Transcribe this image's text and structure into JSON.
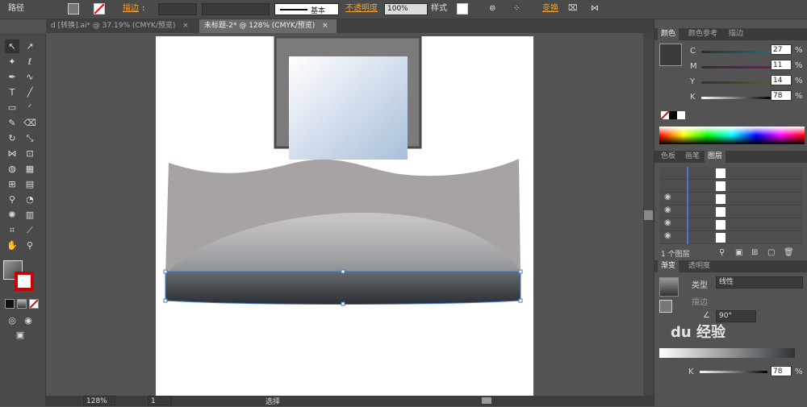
{
  "control_bar": {
    "path_label": "路径",
    "stroke_label": "描边",
    "stroke_style_label": "基本",
    "opacity_label": "不透明度",
    "opacity_value": "100%",
    "style_label": "样式",
    "transform_label": "变换"
  },
  "document_tabs": [
    {
      "label": "d [转换].ai* @ 37.19% (CMYK/预览)",
      "close": "×"
    },
    {
      "label": "未标题-2* @ 128% (CMYK/预览)",
      "close": "×"
    }
  ],
  "color_panel": {
    "tabs": [
      "颜色",
      "颜色参考",
      "描边"
    ],
    "channels": [
      {
        "name": "C",
        "value": "27",
        "unit": "%"
      },
      {
        "name": "M",
        "value": "11",
        "unit": "%"
      },
      {
        "name": "Y",
        "value": "14",
        "unit": "%"
      },
      {
        "name": "K",
        "value": "78",
        "unit": "%"
      }
    ]
  },
  "layers_panel": {
    "tabs": [
      "色板",
      "画笔",
      "图层"
    ],
    "layer_count": "1 个图层",
    "rows": 6
  },
  "gradient_panel": {
    "tabs": [
      "渐变",
      "透明度"
    ],
    "type_label": "类型",
    "type_value": "线性",
    "stroke_label": "描边",
    "angle_value": "90°",
    "k_label": "K",
    "k_value": "78",
    "k_unit": "%"
  },
  "status_bar": {
    "zoom": "128%",
    "page": "1",
    "mode": "选择"
  },
  "watermark": "du 经验",
  "colors": {
    "accent_orange": "#f0a030",
    "panel_bg": "#535353",
    "artboard": "#ffffff"
  }
}
